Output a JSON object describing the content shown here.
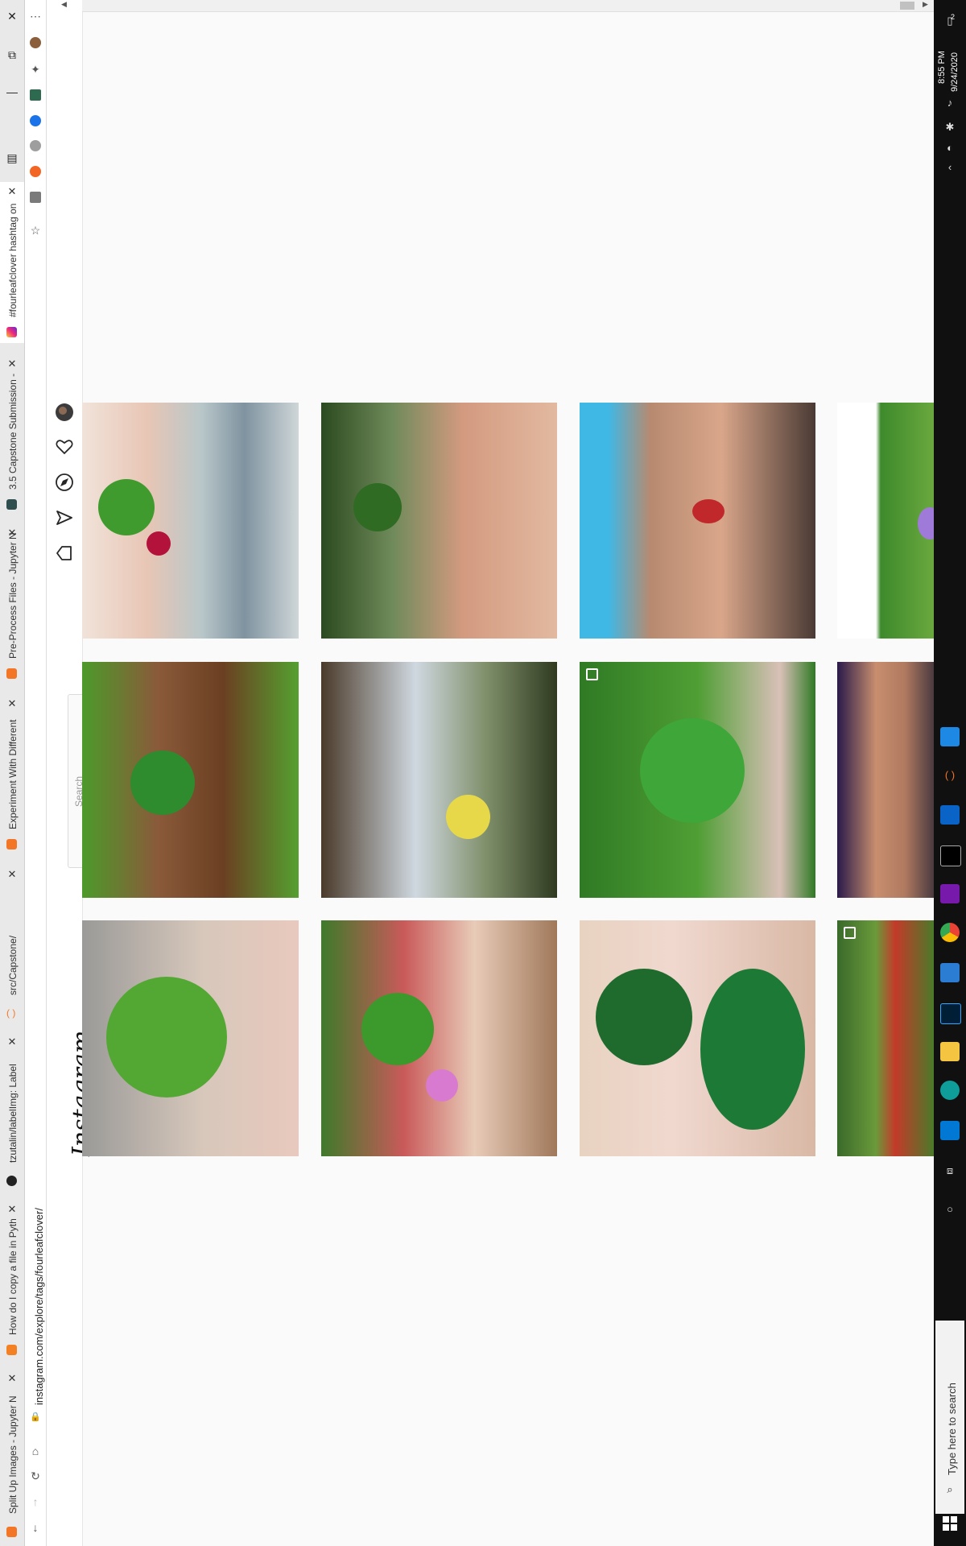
{
  "browser": {
    "tabs": [
      {
        "title": "#fourleafclover hashtag on",
        "active": true
      },
      {
        "title": "3.5 Capstone Submission -",
        "active": false
      },
      {
        "title": "Pre-Process Files - Jupyter N",
        "active": false
      },
      {
        "title": "Experiment With Different",
        "active": false
      },
      {
        "title": "src/Capstone/",
        "active": false
      },
      {
        "title": "tzutalin/labelImg: Label",
        "active": false
      },
      {
        "title": "How do I copy a file in Pyth",
        "active": false
      },
      {
        "title": "Split Up Images - Jupyter N",
        "active": false
      }
    ],
    "window_controls": {
      "close": "✕",
      "restore": "⧉",
      "minimize": "—"
    },
    "url": "instagram.com/explore/tags/fourleafclover/",
    "menu_glyph": "⋯"
  },
  "instagram": {
    "logo": "Instagram",
    "search_placeholder": "Search"
  },
  "taskbar": {
    "time": "8:55 PM",
    "date": "9/24/2020",
    "search_placeholder": "Type here to search",
    "notification_count": "2"
  }
}
